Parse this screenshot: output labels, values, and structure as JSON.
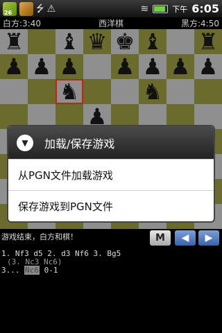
{
  "statusbar": {
    "badge_count": "26",
    "usb_icon": "usb-icon",
    "warning_icon": "warning-icon",
    "wifi_icon": "wifi-icon",
    "battery_icon": "battery-icon",
    "battery_level": 0.9,
    "ampm": "下午",
    "time": "6:05"
  },
  "clocks": {
    "white": "白方:3:40",
    "title": "西洋棋",
    "black": "黑方:4:50"
  },
  "board": {
    "colors": {
      "light": "#8f8f8f",
      "dark": "#6b6b2e",
      "selection": "#c0231a"
    },
    "squares": [
      [
        "♜",
        "",
        "♝",
        "♛",
        "♚",
        "♝",
        "",
        "♜"
      ],
      [
        "♟",
        "♟",
        "♟",
        "",
        "♟",
        "♟",
        "♟",
        "♟"
      ],
      [
        "",
        "",
        "♞",
        "",
        "",
        "♞",
        "",
        ""
      ],
      [
        "",
        "",
        "",
        "♟",
        "",
        "",
        "",
        ""
      ],
      [
        "",
        "",
        "",
        "",
        "",
        "",
        "♙",
        ""
      ],
      [
        "",
        "",
        "",
        "",
        "",
        "",
        "",
        ""
      ],
      [
        "",
        "",
        "",
        "",
        "",
        "",
        "",
        ""
      ],
      [
        "",
        "",
        "",
        "",
        "",
        "",
        "",
        ""
      ]
    ],
    "selected": "c6"
  },
  "dialog": {
    "title": "加载/保存游戏",
    "items": [
      {
        "label": "从PGN文件加载游戏"
      },
      {
        "label": "保存游戏到PGN文件"
      }
    ]
  },
  "controls": {
    "status": "游戏结束，白方和棋！",
    "mode_button": "M",
    "back_icon": "arrow-left-icon",
    "forward_icon": "arrow-right-icon"
  },
  "moves": {
    "line1": "1. Nf3 d5 2. d3 Nf6 3. Bg5",
    "line2": "(3. Nc3 Nc6)",
    "line3_prefix": "3...",
    "line3_highlight": "Nc6",
    "line3_suffix": "0-1"
  }
}
